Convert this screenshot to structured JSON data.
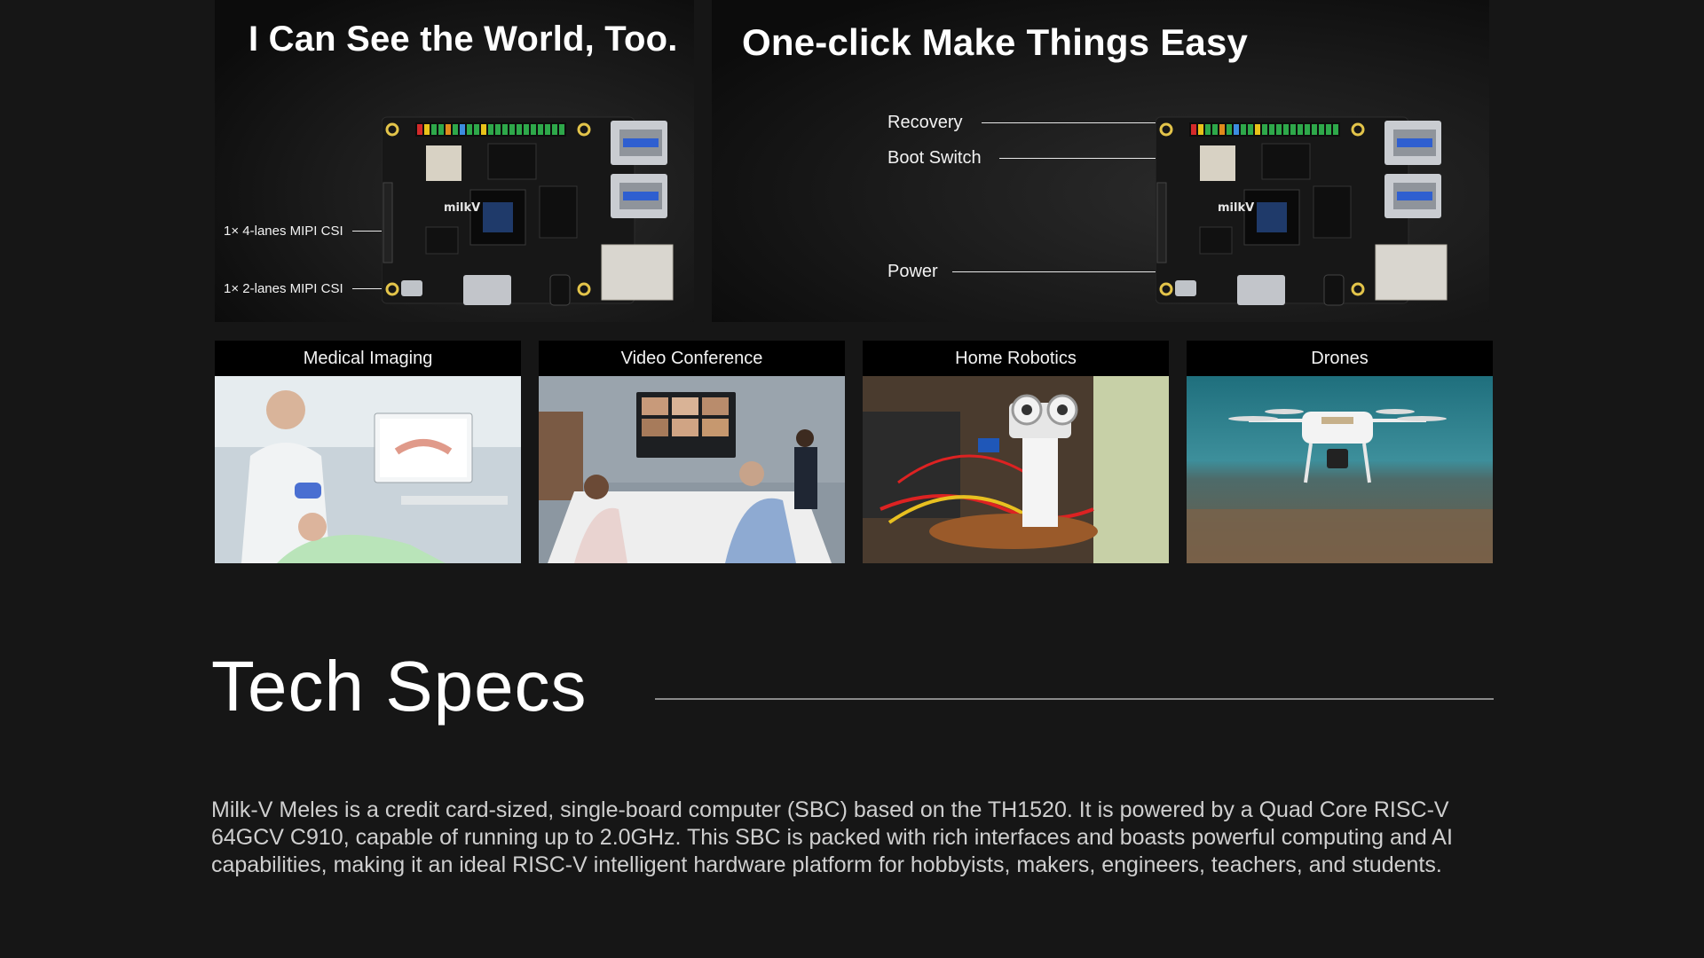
{
  "feature_panels": {
    "vision": {
      "title": "I Can See the World, Too.",
      "callouts": [
        "1× 4-lanes MIPI CSI",
        "1× 2-lanes MIPI CSI"
      ]
    },
    "oneclick": {
      "title": "One-click Make Things Easy",
      "callouts": [
        "Recovery",
        "Boot Switch",
        "Power"
      ]
    },
    "board_silkscreen": "milkV"
  },
  "use_cases": [
    {
      "label": "Medical Imaging"
    },
    {
      "label": "Video Conference"
    },
    {
      "label": "Home Robotics"
    },
    {
      "label": "Drones"
    }
  ],
  "tech_specs": {
    "heading": "Tech Specs",
    "description": "Milk-V Meles is a credit card-sized, single-board computer (SBC) based on the TH1520. It is powered by a Quad Core RISC-V 64GCV C910, capable of running up to 2.0GHz. This SBC is packed with rich interfaces and boasts powerful computing and AI capabilities, making it an ideal RISC-V intelligent hardware platform for hobbyists, makers, engineers, teachers, and students."
  },
  "colors": {
    "page_bg": "#161616",
    "pcb": "#1a1a1a",
    "usb_port": "#c9ccd1",
    "usb_tongue": "#2f5fd0",
    "text_muted": "#cfcfcf"
  }
}
